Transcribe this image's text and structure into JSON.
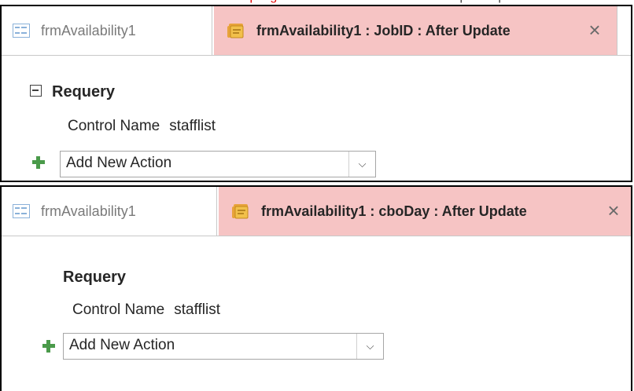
{
  "panels": [
    {
      "tabs": {
        "inactive_label": "frmAvailability1",
        "active_label": "frmAvailability1 : JobID : After Update"
      },
      "action": {
        "name": "Requery",
        "collapsible": true,
        "argument_label": "Control Name",
        "argument_value": "stafflist"
      },
      "add_action": {
        "value": "Add New Action"
      }
    },
    {
      "tabs": {
        "inactive_label": "frmAvailability1",
        "active_label": "frmAvailability1 : cboDay : After Update"
      },
      "action": {
        "name": "Requery",
        "collapsible": false,
        "argument_label": "Control Name",
        "argument_value": "stafflist"
      },
      "add_action": {
        "value": "Add New Action"
      }
    }
  ],
  "icons": {
    "form": "form-object-icon",
    "macro": "macro-scroll-icon",
    "close": "close-icon",
    "collapse": "collapse-minus-icon",
    "add": "add-plus-icon",
    "dropdown": "chevron-down-icon"
  },
  "colors": {
    "active_tab_bg": "#f6c4c4",
    "add_icon": "#4a9a4a",
    "form_icon": "#8ab1d9"
  }
}
